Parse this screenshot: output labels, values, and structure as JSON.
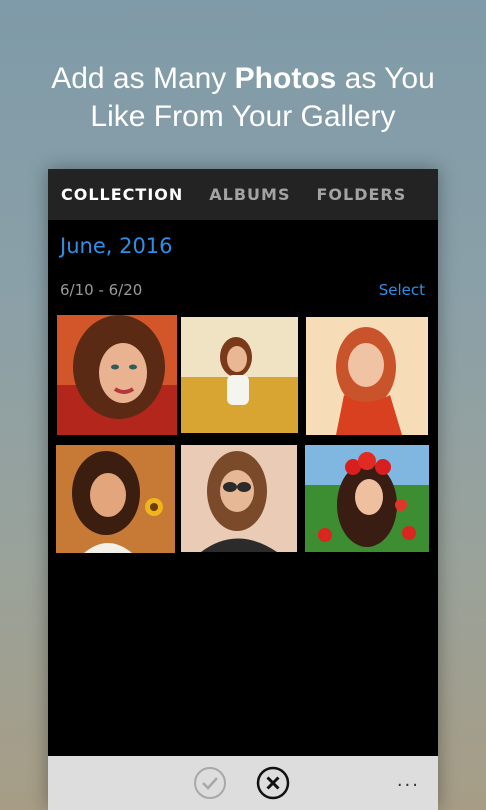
{
  "headline": {
    "line1_pre": "Add as Many ",
    "line1_bold": "Photos",
    "line1_post": " as You",
    "line2": "Like From Your Gallery"
  },
  "tabs": [
    {
      "label": "COLLECTION",
      "active": true
    },
    {
      "label": "ALBUMS",
      "active": false
    },
    {
      "label": "FOLDERS",
      "active": false
    }
  ],
  "section": {
    "month": "June, 2016",
    "date_range": "6/10 - 6/20",
    "select_label": "Select"
  },
  "photos": [
    {
      "name": "photo-woman-red-top",
      "bg": "#c2481e"
    },
    {
      "name": "photo-woman-golden-field",
      "bg": "#d8b24a"
    },
    {
      "name": "photo-woman-red-scarf",
      "bg": "#f3cfa6"
    },
    {
      "name": "photo-woman-sunflower",
      "bg": "#c9813b"
    },
    {
      "name": "photo-woman-sunglasses",
      "bg": "#e4c4ad"
    },
    {
      "name": "photo-woman-flower-crown",
      "bg": "#3e9a36"
    }
  ],
  "appbar": {
    "accept_icon": "check-icon",
    "cancel_icon": "close-icon",
    "more_label": "..."
  }
}
